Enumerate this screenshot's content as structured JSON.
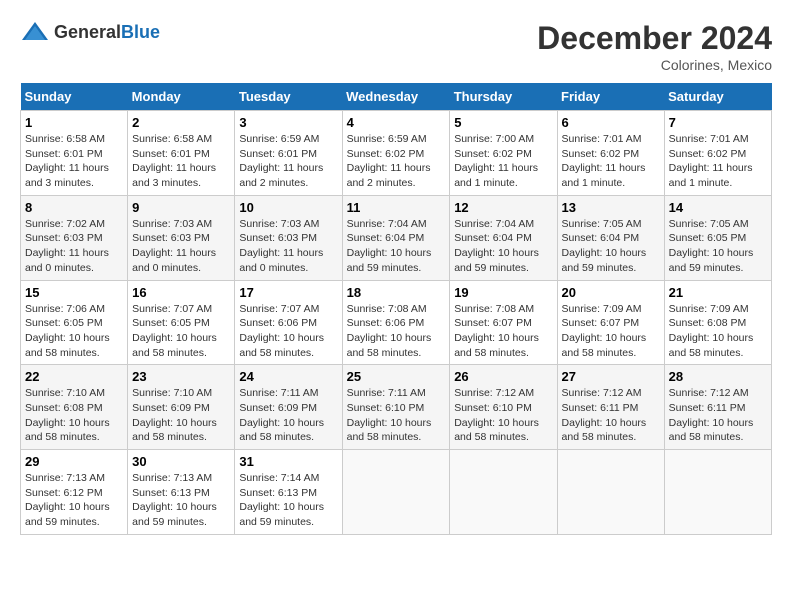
{
  "header": {
    "logo_general": "General",
    "logo_blue": "Blue",
    "month_year": "December 2024",
    "location": "Colorines, Mexico"
  },
  "weekdays": [
    "Sunday",
    "Monday",
    "Tuesday",
    "Wednesday",
    "Thursday",
    "Friday",
    "Saturday"
  ],
  "weeks": [
    [
      {
        "day": "1",
        "sunrise": "Sunrise: 6:58 AM",
        "sunset": "Sunset: 6:01 PM",
        "daylight": "Daylight: 11 hours and 3 minutes."
      },
      {
        "day": "2",
        "sunrise": "Sunrise: 6:58 AM",
        "sunset": "Sunset: 6:01 PM",
        "daylight": "Daylight: 11 hours and 3 minutes."
      },
      {
        "day": "3",
        "sunrise": "Sunrise: 6:59 AM",
        "sunset": "Sunset: 6:01 PM",
        "daylight": "Daylight: 11 hours and 2 minutes."
      },
      {
        "day": "4",
        "sunrise": "Sunrise: 6:59 AM",
        "sunset": "Sunset: 6:02 PM",
        "daylight": "Daylight: 11 hours and 2 minutes."
      },
      {
        "day": "5",
        "sunrise": "Sunrise: 7:00 AM",
        "sunset": "Sunset: 6:02 PM",
        "daylight": "Daylight: 11 hours and 1 minute."
      },
      {
        "day": "6",
        "sunrise": "Sunrise: 7:01 AM",
        "sunset": "Sunset: 6:02 PM",
        "daylight": "Daylight: 11 hours and 1 minute."
      },
      {
        "day": "7",
        "sunrise": "Sunrise: 7:01 AM",
        "sunset": "Sunset: 6:02 PM",
        "daylight": "Daylight: 11 hours and 1 minute."
      }
    ],
    [
      {
        "day": "8",
        "sunrise": "Sunrise: 7:02 AM",
        "sunset": "Sunset: 6:03 PM",
        "daylight": "Daylight: 11 hours and 0 minutes."
      },
      {
        "day": "9",
        "sunrise": "Sunrise: 7:03 AM",
        "sunset": "Sunset: 6:03 PM",
        "daylight": "Daylight: 11 hours and 0 minutes."
      },
      {
        "day": "10",
        "sunrise": "Sunrise: 7:03 AM",
        "sunset": "Sunset: 6:03 PM",
        "daylight": "Daylight: 11 hours and 0 minutes."
      },
      {
        "day": "11",
        "sunrise": "Sunrise: 7:04 AM",
        "sunset": "Sunset: 6:04 PM",
        "daylight": "Daylight: 10 hours and 59 minutes."
      },
      {
        "day": "12",
        "sunrise": "Sunrise: 7:04 AM",
        "sunset": "Sunset: 6:04 PM",
        "daylight": "Daylight: 10 hours and 59 minutes."
      },
      {
        "day": "13",
        "sunrise": "Sunrise: 7:05 AM",
        "sunset": "Sunset: 6:04 PM",
        "daylight": "Daylight: 10 hours and 59 minutes."
      },
      {
        "day": "14",
        "sunrise": "Sunrise: 7:05 AM",
        "sunset": "Sunset: 6:05 PM",
        "daylight": "Daylight: 10 hours and 59 minutes."
      }
    ],
    [
      {
        "day": "15",
        "sunrise": "Sunrise: 7:06 AM",
        "sunset": "Sunset: 6:05 PM",
        "daylight": "Daylight: 10 hours and 58 minutes."
      },
      {
        "day": "16",
        "sunrise": "Sunrise: 7:07 AM",
        "sunset": "Sunset: 6:05 PM",
        "daylight": "Daylight: 10 hours and 58 minutes."
      },
      {
        "day": "17",
        "sunrise": "Sunrise: 7:07 AM",
        "sunset": "Sunset: 6:06 PM",
        "daylight": "Daylight: 10 hours and 58 minutes."
      },
      {
        "day": "18",
        "sunrise": "Sunrise: 7:08 AM",
        "sunset": "Sunset: 6:06 PM",
        "daylight": "Daylight: 10 hours and 58 minutes."
      },
      {
        "day": "19",
        "sunrise": "Sunrise: 7:08 AM",
        "sunset": "Sunset: 6:07 PM",
        "daylight": "Daylight: 10 hours and 58 minutes."
      },
      {
        "day": "20",
        "sunrise": "Sunrise: 7:09 AM",
        "sunset": "Sunset: 6:07 PM",
        "daylight": "Daylight: 10 hours and 58 minutes."
      },
      {
        "day": "21",
        "sunrise": "Sunrise: 7:09 AM",
        "sunset": "Sunset: 6:08 PM",
        "daylight": "Daylight: 10 hours and 58 minutes."
      }
    ],
    [
      {
        "day": "22",
        "sunrise": "Sunrise: 7:10 AM",
        "sunset": "Sunset: 6:08 PM",
        "daylight": "Daylight: 10 hours and 58 minutes."
      },
      {
        "day": "23",
        "sunrise": "Sunrise: 7:10 AM",
        "sunset": "Sunset: 6:09 PM",
        "daylight": "Daylight: 10 hours and 58 minutes."
      },
      {
        "day": "24",
        "sunrise": "Sunrise: 7:11 AM",
        "sunset": "Sunset: 6:09 PM",
        "daylight": "Daylight: 10 hours and 58 minutes."
      },
      {
        "day": "25",
        "sunrise": "Sunrise: 7:11 AM",
        "sunset": "Sunset: 6:10 PM",
        "daylight": "Daylight: 10 hours and 58 minutes."
      },
      {
        "day": "26",
        "sunrise": "Sunrise: 7:12 AM",
        "sunset": "Sunset: 6:10 PM",
        "daylight": "Daylight: 10 hours and 58 minutes."
      },
      {
        "day": "27",
        "sunrise": "Sunrise: 7:12 AM",
        "sunset": "Sunset: 6:11 PM",
        "daylight": "Daylight: 10 hours and 58 minutes."
      },
      {
        "day": "28",
        "sunrise": "Sunrise: 7:12 AM",
        "sunset": "Sunset: 6:11 PM",
        "daylight": "Daylight: 10 hours and 58 minutes."
      }
    ],
    [
      {
        "day": "29",
        "sunrise": "Sunrise: 7:13 AM",
        "sunset": "Sunset: 6:12 PM",
        "daylight": "Daylight: 10 hours and 59 minutes."
      },
      {
        "day": "30",
        "sunrise": "Sunrise: 7:13 AM",
        "sunset": "Sunset: 6:13 PM",
        "daylight": "Daylight: 10 hours and 59 minutes."
      },
      {
        "day": "31",
        "sunrise": "Sunrise: 7:14 AM",
        "sunset": "Sunset: 6:13 PM",
        "daylight": "Daylight: 10 hours and 59 minutes."
      },
      null,
      null,
      null,
      null
    ]
  ]
}
